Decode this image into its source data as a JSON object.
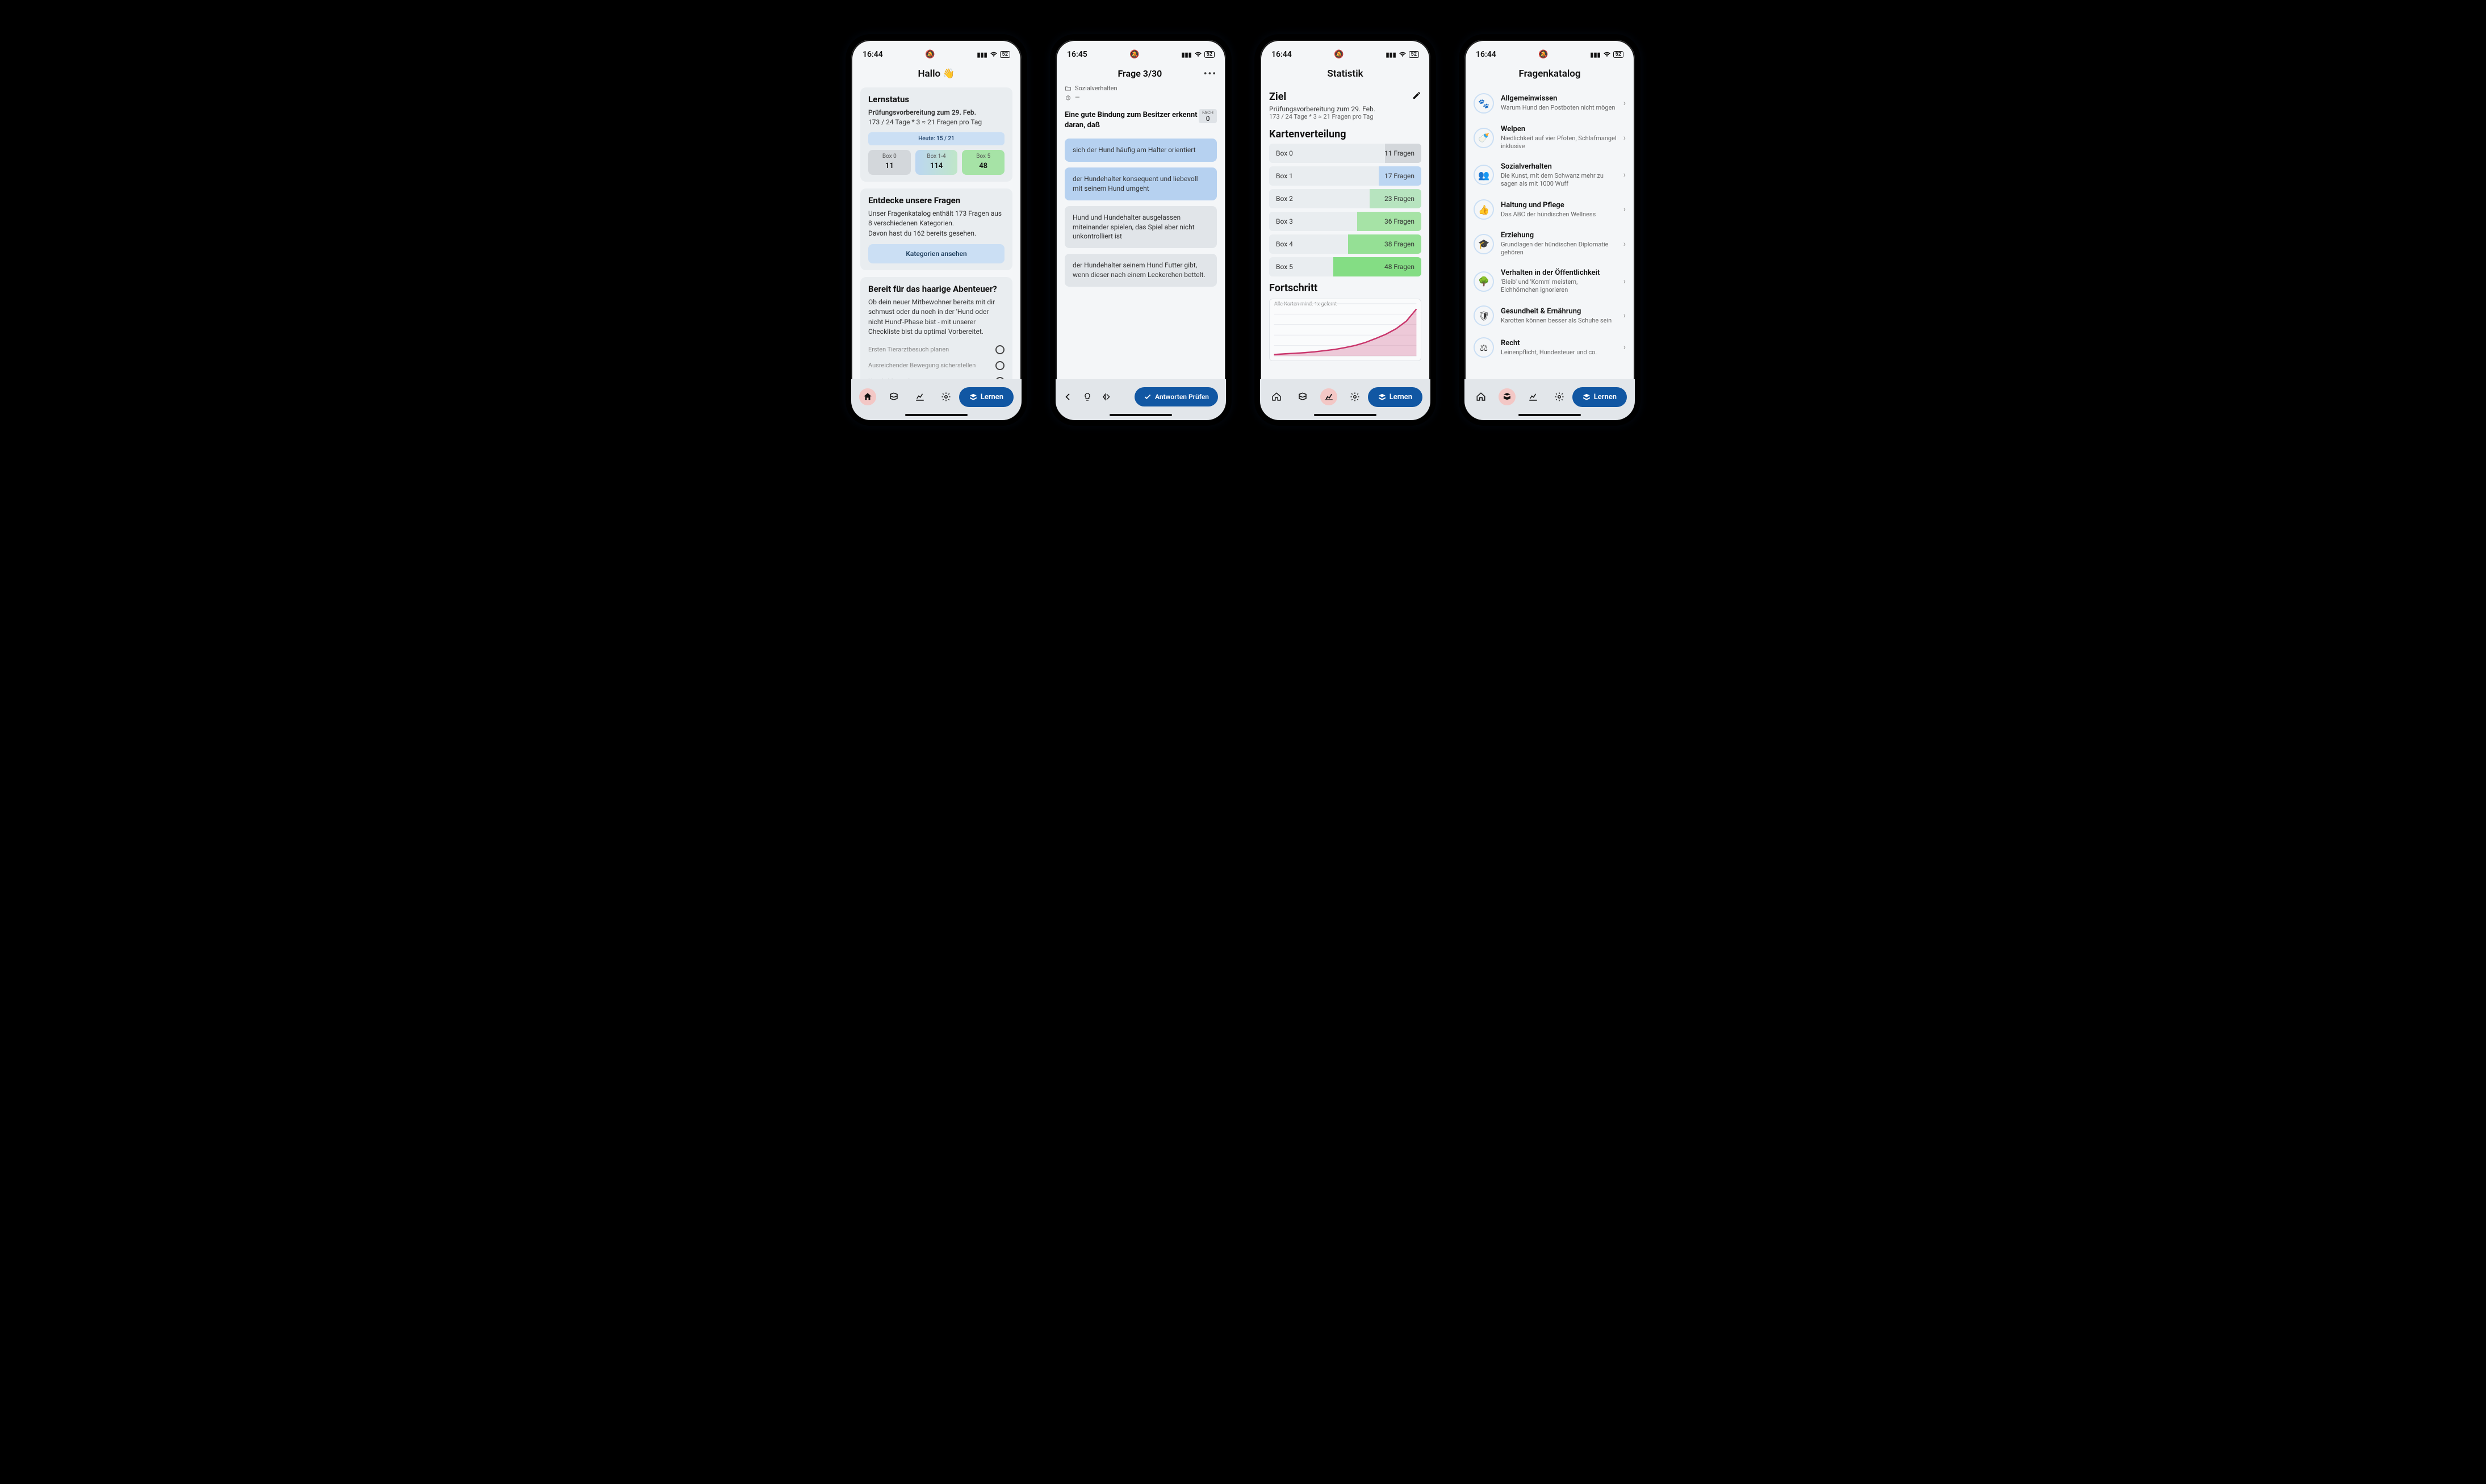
{
  "statusbar": {
    "time1": "16:44",
    "time2": "16:45",
    "battery": "52"
  },
  "screen1": {
    "title": "Hallo 👋",
    "lernstatus": {
      "heading": "Lernstatus",
      "sub": "Prüfungsvorbereitung zum 29. Feb.",
      "calc": "173 / 24 Tage * 3 ≈ 21 Fragen pro Tag",
      "today": "Heute: 15 / 21",
      "boxes": [
        {
          "label": "Box 0",
          "value": "11"
        },
        {
          "label": "Box 1-4",
          "value": "114"
        },
        {
          "label": "Box 5",
          "value": "48"
        }
      ]
    },
    "discover": {
      "heading": "Entdecke unsere Fragen",
      "body1": "Unser Fragenkatalog enthält 173 Fragen aus 8 verschiedenen Kategorien.",
      "body2": "Davon hast du 162 bereits gesehen.",
      "button": "Kategorien ansehen"
    },
    "adventure": {
      "heading": "Bereit für das haarige Abenteuer?",
      "body": "Ob dein neuer Mitbewohner bereits mit dir schmust oder du noch in der 'Hund oder nicht Hund'-Phase bist - mit unserer Checkliste bist du optimal Vorbereitet.",
      "items": [
        "Ersten Tierarztbesuch planen",
        "Ausreichender Bewegung sicherstellen",
        "Hund chippen lassen"
      ]
    },
    "learn": "Lernen"
  },
  "screen2": {
    "title": "Frage 3/30",
    "category": "Sozialverhalten",
    "time": "—",
    "fach_label": "FACH",
    "fach": "0",
    "question": "Eine gute Bindung zum Besitzer erkennt man daran, daß",
    "answers": [
      {
        "text": "sich der Hund häufig am Halter orientiert",
        "sel": true
      },
      {
        "text": "der Hundehalter konsequent und liebevoll mit seinem Hund umgeht",
        "sel": true
      },
      {
        "text": "Hund und Hundehalter ausgelassen miteinander spielen, das Spiel aber nicht unkontrolliert ist",
        "sel": false
      },
      {
        "text": "der Hundehalter seinem Hund Futter gibt, wenn dieser nach einem Leckerchen bettelt.",
        "sel": false
      }
    ],
    "check": "Antworten Prüfen"
  },
  "screen3": {
    "title": "Statistik",
    "ziel": {
      "heading": "Ziel",
      "sub": "Prüfungsvorbereitung zum 29. Feb.",
      "calc": "173 / 24 Tage * 3 ≈ 21 Fragen pro Tag"
    },
    "dist": {
      "heading": "Kartenverteilung",
      "rows": [
        {
          "label": "Box 0",
          "count": "11 Fragen",
          "fill": 24,
          "color": "#d3d7db"
        },
        {
          "label": "Box 1",
          "count": "17 Fragen",
          "fill": 28,
          "color": "#bcd6f2"
        },
        {
          "label": "Box 2",
          "count": "23 Fragen",
          "fill": 34,
          "color": "#b7e4bf"
        },
        {
          "label": "Box 3",
          "count": "36 Fragen",
          "fill": 42,
          "color": "#a6e3a6"
        },
        {
          "label": "Box 4",
          "count": "38 Fragen",
          "fill": 48,
          "color": "#95e095"
        },
        {
          "label": "Box 5",
          "count": "48 Fragen",
          "fill": 58,
          "color": "#84dd84"
        }
      ]
    },
    "prog": {
      "heading": "Fortschritt",
      "label": "Alle Karten mind. 1x gelernt"
    },
    "learn": "Lernen"
  },
  "screen4": {
    "title": "Fragenkatalog",
    "cats": [
      {
        "t": "Allgemeinwissen",
        "s": "Warum Hund den Postboten nicht mögen",
        "icon": "🐾"
      },
      {
        "t": "Welpen",
        "s": "Niedlichkeit auf vier Pfoten, Schlafmangel inklusive",
        "icon": "🍼"
      },
      {
        "t": "Sozialverhalten",
        "s": "Die Kunst, mit dem Schwanz mehr zu sagen als mit 1000 Wuff",
        "icon": "👥"
      },
      {
        "t": "Haltung und Pflege",
        "s": "Das ABC der hündischen Wellness",
        "icon": "👍"
      },
      {
        "t": "Erziehung",
        "s": "Grundlagen der hündischen Diplomatie gehören",
        "icon": "🎓"
      },
      {
        "t": "Verhalten in der Öffentlichkeit",
        "s": "'Bleib' und 'Komm' meistern, Eichhörnchen ignorieren",
        "icon": "🌳"
      },
      {
        "t": "Gesundheit & Ernährung",
        "s": "Karotten können besser als Schuhe sein",
        "icon": "🛡"
      },
      {
        "t": "Recht",
        "s": "Leinenpflicht, Hundesteuer und co.",
        "icon": "⚖"
      }
    ],
    "learn": "Lernen"
  },
  "chart_data": {
    "type": "area",
    "title": "Alle Karten mind. 1x gelernt",
    "x": [
      0,
      1,
      2,
      3,
      4,
      5,
      6,
      7,
      8,
      9,
      10,
      11,
      12,
      13,
      14
    ],
    "values": [
      5,
      7,
      9,
      11,
      14,
      18,
      22,
      28,
      35,
      45,
      58,
      72,
      90,
      115,
      155
    ],
    "ylim": [
      0,
      173
    ],
    "color": "#c9356b"
  }
}
